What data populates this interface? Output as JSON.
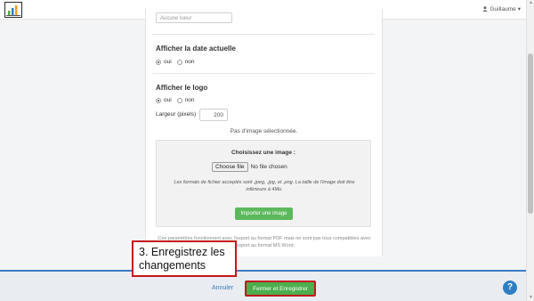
{
  "header": {
    "user_name": "Guillaume",
    "user_caret": "▾"
  },
  "form": {
    "partial_input_value": "Aucune lueur",
    "date_section": {
      "title": "Afficher la date actuelle",
      "options": [
        {
          "label": "oui",
          "selected": true
        },
        {
          "label": "non",
          "selected": false
        }
      ]
    },
    "logo_section": {
      "title": "Afficher le logo",
      "options": [
        {
          "label": "oui",
          "selected": true
        },
        {
          "label": "non",
          "selected": false
        }
      ],
      "width_label": "Largeur (pixels)",
      "width_value": "200"
    },
    "no_image_text": "Pas d'image sélectionnée.",
    "upload": {
      "title": "Choisissez une image :",
      "choose_button": "Choose file",
      "no_file_text": "No file chosen",
      "formats_note": "Les formats de fichier acceptés sont .jpeg, .jpg, et .png. La taille de l'image doit être inférieure à 4Mo.",
      "import_button": "Importer une image"
    },
    "footnote": "Ces paramètres fonctionnent avec l'export au format PDF mais ne sont pas tous compatibles avec l'export au format MS Word."
  },
  "footer": {
    "cancel_label": "Annuler",
    "save_label": "Fermer et Enregistrer",
    "help_label": "?"
  },
  "callout": {
    "text": "3. Enregistrez les changements"
  },
  "colors": {
    "accent_blue": "#3b7dc4",
    "success_green": "#5cb85c",
    "highlight_red": "#c4161c"
  },
  "icons": {
    "logo": "bar-chart-logo-icon",
    "user": "person-icon",
    "help": "question-mark-icon"
  }
}
